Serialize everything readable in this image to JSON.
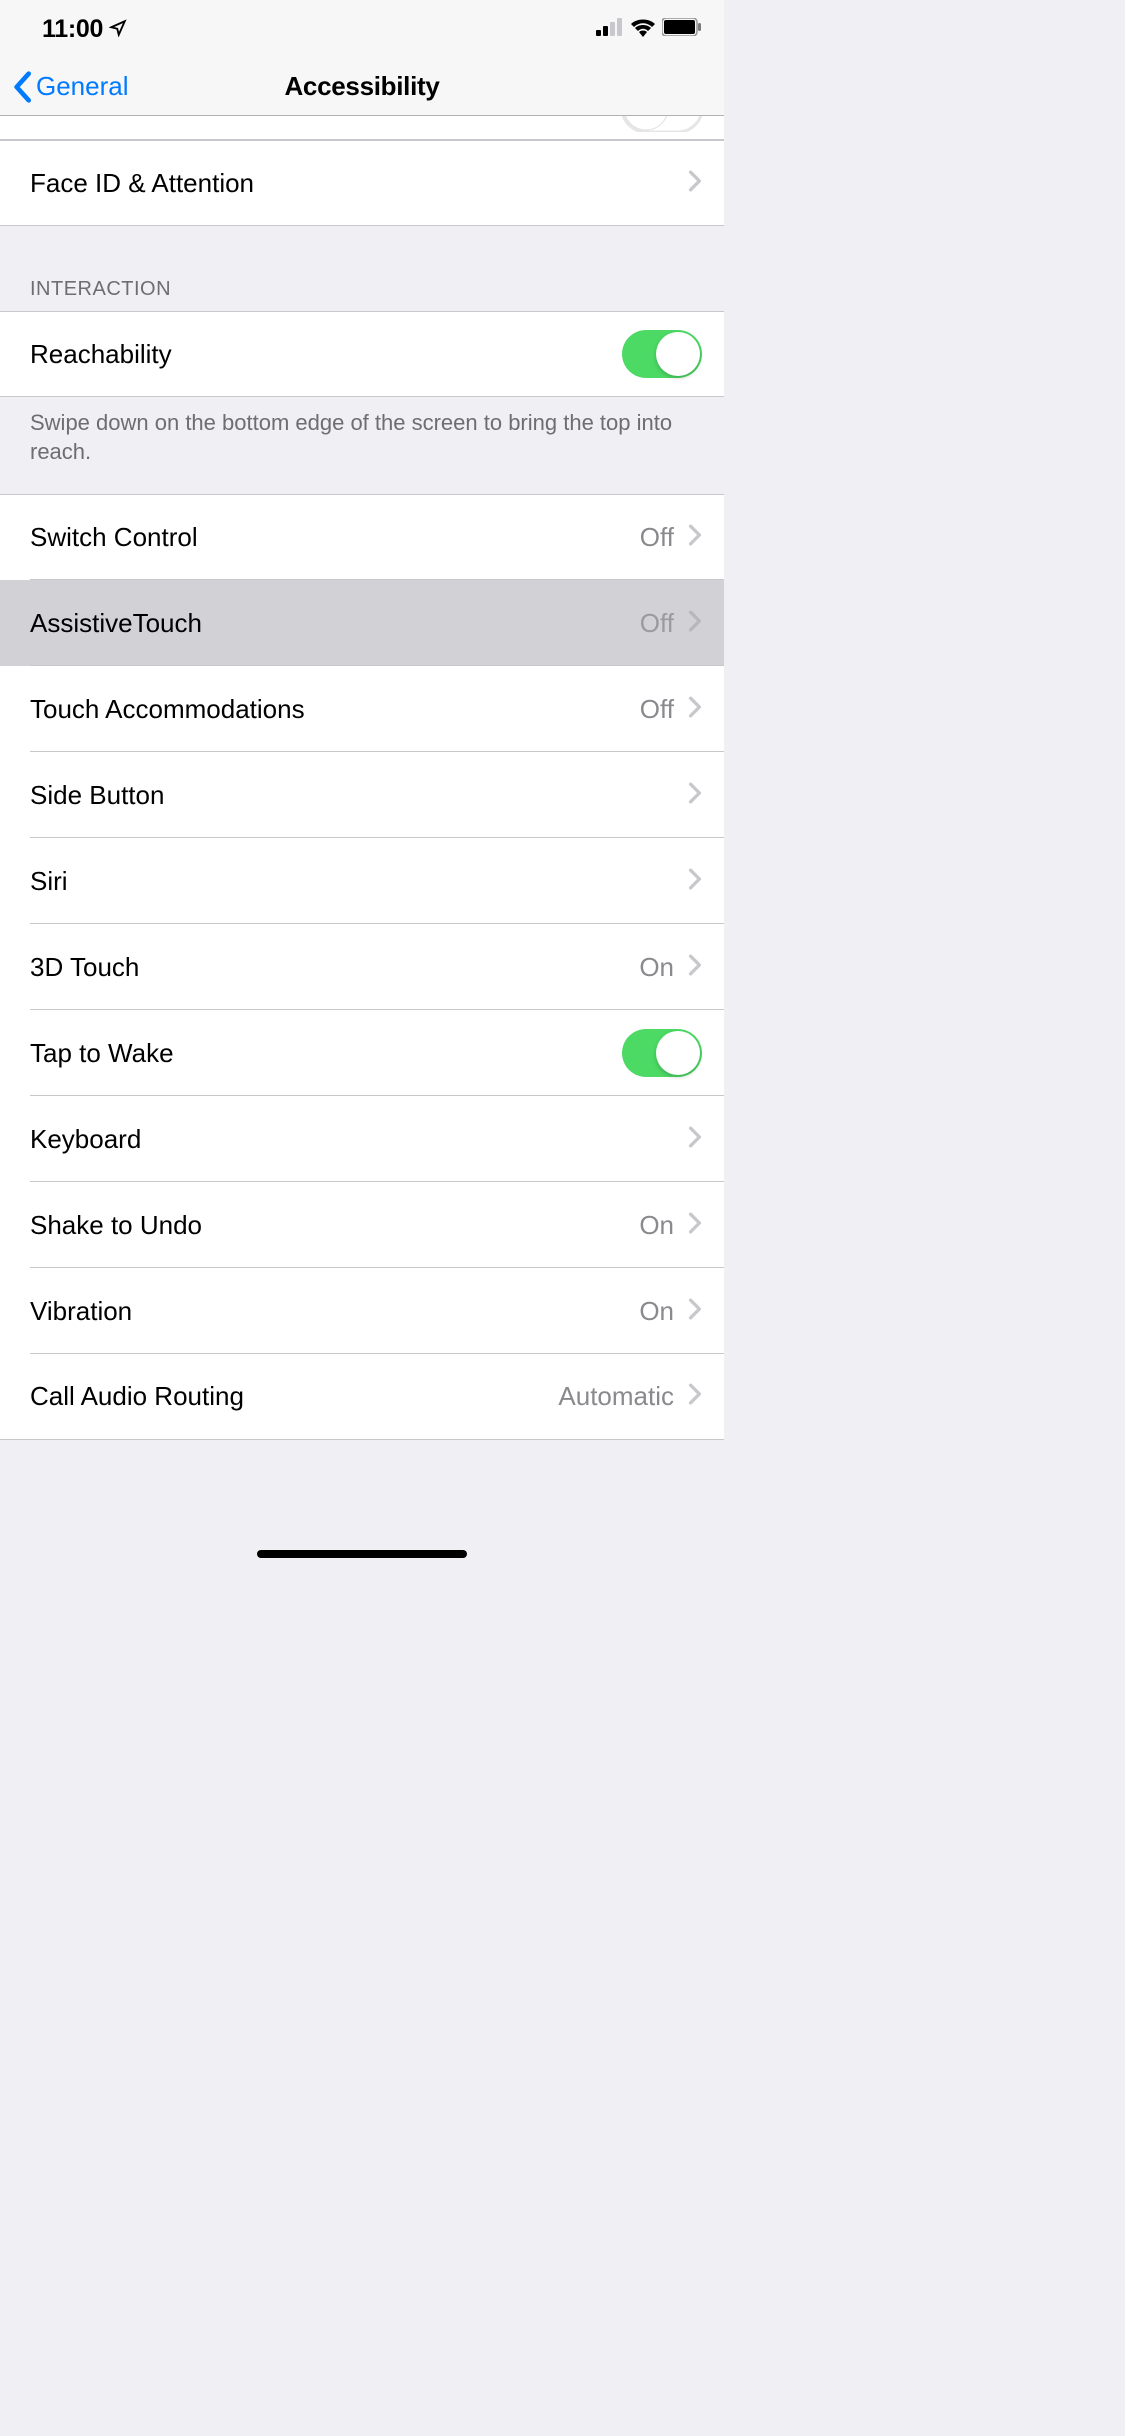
{
  "statusBar": {
    "time": "11:00"
  },
  "nav": {
    "back": "General",
    "title": "Accessibility"
  },
  "sections": {
    "faceId": {
      "label": "Face ID & Attention"
    },
    "interaction": {
      "header": "INTERACTION",
      "reachability": {
        "label": "Reachability",
        "on": true
      },
      "footer": "Swipe down on the bottom edge of the screen to bring the top into reach.",
      "switchControl": {
        "label": "Switch Control",
        "detail": "Off"
      },
      "assistiveTouch": {
        "label": "AssistiveTouch",
        "detail": "Off"
      },
      "touchAccommodations": {
        "label": "Touch Accommodations",
        "detail": "Off"
      },
      "sideButton": {
        "label": "Side Button"
      },
      "siri": {
        "label": "Siri"
      },
      "threeDTouch": {
        "label": "3D Touch",
        "detail": "On"
      },
      "tapToWake": {
        "label": "Tap to Wake",
        "on": true
      },
      "keyboard": {
        "label": "Keyboard"
      },
      "shakeToUndo": {
        "label": "Shake to Undo",
        "detail": "On"
      },
      "vibration": {
        "label": "Vibration",
        "detail": "On"
      },
      "callAudioRouting": {
        "label": "Call Audio Routing",
        "detail": "Automatic"
      }
    }
  }
}
